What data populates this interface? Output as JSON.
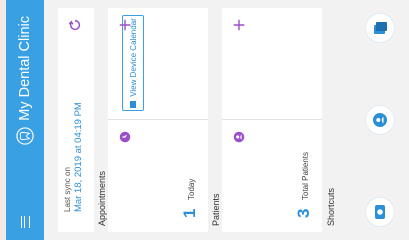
{
  "app_title": "My Dental Clinic",
  "sync": {
    "label": "Last sync on",
    "value": "Mar 18, 2019 at 04:19 PM"
  },
  "sections": {
    "appointments": "Appointments",
    "patients": "Patients",
    "shortcuts": "Shortcuts"
  },
  "appointments": {
    "today_count": "1",
    "today_label": "Today",
    "calendar_button": "View Device Calendar"
  },
  "patients": {
    "total_count": "3",
    "total_label": "Total Patients"
  },
  "icons": [
    "menu-icon",
    "tooth-logo-icon",
    "refresh-icon",
    "plus-icon",
    "purple-badge-icon",
    "calendar-icon",
    "shortcut-icon"
  ],
  "colors": {
    "appbar": "#3aa0e4",
    "accent_blue": "#2a8fd6",
    "accent_purple": "#9b4fc9"
  }
}
